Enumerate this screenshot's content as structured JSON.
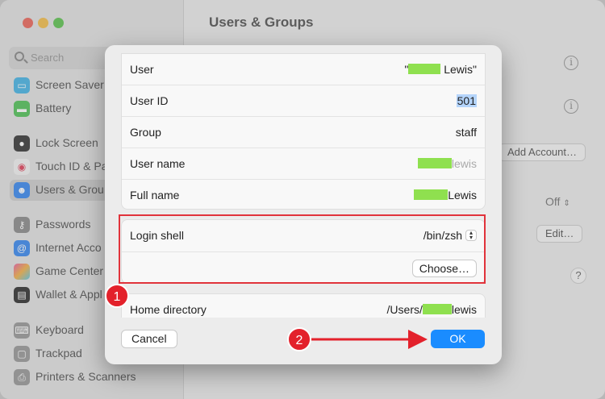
{
  "window": {
    "title": "Users & Groups",
    "colors": {
      "traffic_red": "#ec6a5e",
      "traffic_yellow": "#f4bf4f",
      "traffic_green": "#61c554"
    }
  },
  "sidebar": {
    "search_placeholder": "Search",
    "items": [
      {
        "label": "Screen Saver",
        "icon": "screen-saver-icon",
        "color": "#49b5e6"
      },
      {
        "label": "Battery",
        "icon": "battery-icon",
        "color": "#55c35b"
      },
      {
        "label": "Lock Screen",
        "icon": "lock-icon",
        "color": "#3a3a3a"
      },
      {
        "label": "Touch ID & Pa",
        "icon": "fingerprint-icon",
        "color": "#f2f2f2"
      },
      {
        "label": "Users & Grou",
        "icon": "users-icon",
        "color": "#3d8bf0",
        "selected": true
      },
      {
        "label": "Passwords",
        "icon": "key-icon",
        "color": "#8e8e8e"
      },
      {
        "label": "Internet Acco",
        "icon": "at-icon",
        "color": "#3d8bf0"
      },
      {
        "label": "Game Center",
        "icon": "game-center-icon",
        "color": "#e865a5"
      },
      {
        "label": "Wallet & Appl",
        "icon": "wallet-icon",
        "color": "#333333"
      },
      {
        "label": "Keyboard",
        "icon": "keyboard-icon",
        "color": "#9a9a9a"
      },
      {
        "label": "Trackpad",
        "icon": "trackpad-icon",
        "color": "#9a9a9a"
      },
      {
        "label": "Printers & Scanners",
        "icon": "printer-icon",
        "color": "#9a9a9a"
      }
    ]
  },
  "main": {
    "add_account_label": "Add Account…",
    "off_label": "Off",
    "edit_label": "Edit…",
    "help_label": "?",
    "info_label": "i"
  },
  "sheet": {
    "rows": [
      {
        "label": "User",
        "value_prefix": "\"",
        "value_suffix": " Lewis\""
      },
      {
        "label": "User ID",
        "value": "501"
      },
      {
        "label": "Group",
        "value": "staff"
      },
      {
        "label": "User name",
        "value_suffix": "lewis"
      },
      {
        "label": "Full name",
        "value_suffix": "Lewis"
      }
    ],
    "login_shell": {
      "label": "Login shell",
      "value": "/bin/zsh"
    },
    "choose_label": "Choose…",
    "home_directory": {
      "label": "Home directory",
      "value_prefix": "/Users/",
      "value_suffix": "lewis"
    },
    "cancel_label": "Cancel",
    "ok_label": "OK",
    "accent_color": "#1a8cff"
  },
  "annotations": {
    "badge_1": "1",
    "badge_2": "2",
    "color": "#e3212b"
  }
}
